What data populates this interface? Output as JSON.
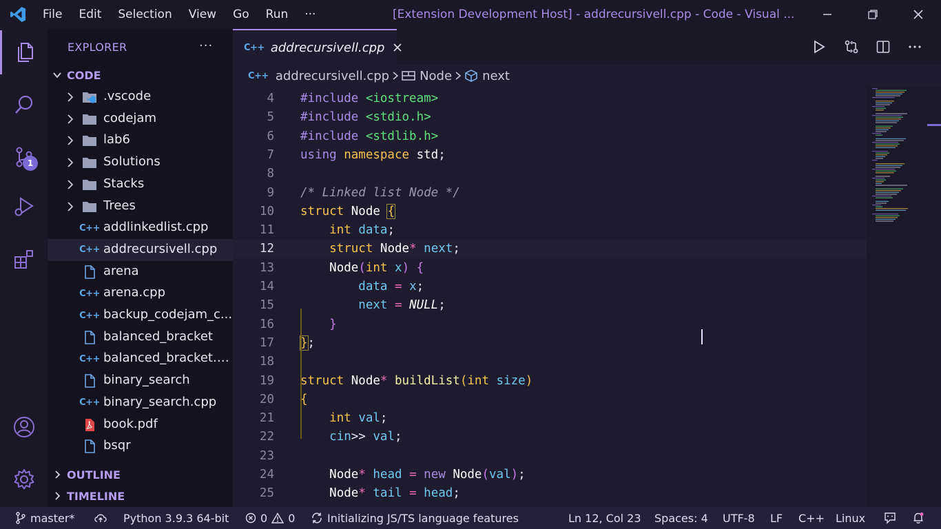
{
  "titlebar": {
    "menus": [
      "File",
      "Edit",
      "Selection",
      "View",
      "Go",
      "Run",
      "···"
    ],
    "title": "[Extension Development Host] - addrecursivell.cpp - Code - Visual ...",
    "accent": "#a98be8"
  },
  "activity": {
    "scm_badge": "1"
  },
  "sidebar": {
    "header": "EXPLORER",
    "more": "···",
    "folder": "CODE",
    "items": [
      {
        "label": ".vscode",
        "icon": "vscode-folder-icon"
      },
      {
        "label": "codejam",
        "icon": "folder-icon"
      },
      {
        "label": "lab6",
        "icon": "folder-icon"
      },
      {
        "label": "Solutions",
        "icon": "folder-icon"
      },
      {
        "label": "Stacks",
        "icon": "folder-icon"
      },
      {
        "label": "Trees",
        "icon": "folder-icon"
      },
      {
        "label": "addlinkedlist.cpp",
        "icon": "cpp-icon"
      },
      {
        "label": "addrecursivell.cpp",
        "icon": "cpp-icon"
      },
      {
        "label": "arena",
        "icon": "file-icon"
      },
      {
        "label": "arena.cpp",
        "icon": "cpp-icon"
      },
      {
        "label": "backup_codejam_c...",
        "icon": "cpp-icon"
      },
      {
        "label": "balanced_bracket",
        "icon": "file-icon"
      },
      {
        "label": "balanced_bracket.c...",
        "icon": "cpp-icon"
      },
      {
        "label": "binary_search",
        "icon": "file-icon"
      },
      {
        "label": "binary_search.cpp",
        "icon": "cpp-icon"
      },
      {
        "label": "book.pdf",
        "icon": "pdf-icon"
      },
      {
        "label": "bsqr",
        "icon": "file-icon"
      }
    ],
    "outline": "OUTLINE",
    "timeline": "TIMELINE"
  },
  "editor": {
    "tab_label": "addrecursivell.cpp",
    "cpp_glyph": "C++",
    "breadcrumb": {
      "file": "addrecursivell.cpp",
      "symbol1": "Node",
      "symbol2": "next"
    },
    "current_line": "12",
    "lines": [
      {
        "n": "4",
        "code": [
          [
            "pp",
            "#include "
          ],
          [
            "inc",
            "<iostream>"
          ]
        ]
      },
      {
        "n": "5",
        "code": [
          [
            "pp",
            "#include "
          ],
          [
            "inc",
            "<stdio.h>"
          ]
        ]
      },
      {
        "n": "6",
        "code": [
          [
            "pp",
            "#include "
          ],
          [
            "inc",
            "<stdlib.h>"
          ]
        ]
      },
      {
        "n": "7",
        "code": [
          [
            "pp",
            "using "
          ],
          [
            "kw",
            "namespace "
          ],
          [
            "cls",
            "std"
          ],
          [
            "punc",
            ";"
          ]
        ]
      },
      {
        "n": "8",
        "code": []
      },
      {
        "n": "9",
        "code": [
          [
            "cmt",
            "/* Linked list Node */"
          ]
        ]
      },
      {
        "n": "10",
        "code": [
          [
            "kw",
            "struct "
          ],
          [
            "cls",
            "Node "
          ],
          [
            "brc hlbrace",
            "{"
          ]
        ]
      },
      {
        "n": "11",
        "code": [
          [
            "punc",
            "    "
          ],
          [
            "typ",
            "int "
          ],
          [
            "var",
            "data"
          ],
          [
            "punc",
            ";"
          ]
        ]
      },
      {
        "n": "12",
        "code": [
          [
            "punc",
            "    "
          ],
          [
            "kw",
            "struct "
          ],
          [
            "cls",
            "Node"
          ],
          [
            "op",
            "* "
          ],
          [
            "var",
            "next"
          ],
          [
            "punc",
            ";"
          ]
        ]
      },
      {
        "n": "13",
        "code": [
          [
            "punc",
            "    "
          ],
          [
            "cls",
            "Node"
          ],
          [
            "par",
            "("
          ],
          [
            "typ",
            "int "
          ],
          [
            "var",
            "x"
          ],
          [
            "par",
            ") "
          ],
          [
            "par",
            "{"
          ]
        ]
      },
      {
        "n": "14",
        "code": [
          [
            "punc",
            "        "
          ],
          [
            "var",
            "data "
          ],
          [
            "op",
            "= "
          ],
          [
            "var",
            "x"
          ],
          [
            "punc",
            ";"
          ]
        ]
      },
      {
        "n": "15",
        "code": [
          [
            "punc",
            "        "
          ],
          [
            "var",
            "next "
          ],
          [
            "op",
            "= "
          ],
          [
            "nul",
            "NULL"
          ],
          [
            "punc",
            ";"
          ]
        ]
      },
      {
        "n": "16",
        "code": [
          [
            "punc",
            "    "
          ],
          [
            "par",
            "}"
          ]
        ]
      },
      {
        "n": "17",
        "code": [
          [
            "brc hlbrace",
            "}"
          ],
          [
            "punc",
            ";"
          ]
        ]
      },
      {
        "n": "18",
        "code": []
      },
      {
        "n": "19",
        "code": [
          [
            "kw",
            "struct "
          ],
          [
            "cls",
            "Node"
          ],
          [
            "op",
            "* "
          ],
          [
            "fn",
            "buildList"
          ],
          [
            "brc",
            "("
          ],
          [
            "typ",
            "int "
          ],
          [
            "var",
            "size"
          ],
          [
            "brc",
            ")"
          ]
        ]
      },
      {
        "n": "20",
        "code": [
          [
            "brc",
            "{"
          ]
        ]
      },
      {
        "n": "21",
        "code": [
          [
            "punc",
            "    "
          ],
          [
            "typ",
            "int "
          ],
          [
            "var",
            "val"
          ],
          [
            "punc",
            ";"
          ]
        ]
      },
      {
        "n": "22",
        "code": [
          [
            "punc",
            "    "
          ],
          [
            "var",
            "cin"
          ],
          [
            "punc",
            ">> "
          ],
          [
            "var",
            "val"
          ],
          [
            "punc",
            ";"
          ]
        ]
      },
      {
        "n": "23",
        "code": []
      },
      {
        "n": "24",
        "code": [
          [
            "punc",
            "    "
          ],
          [
            "cls",
            "Node"
          ],
          [
            "op",
            "* "
          ],
          [
            "var",
            "head "
          ],
          [
            "op",
            "= "
          ],
          [
            "pp",
            "new "
          ],
          [
            "cls",
            "Node"
          ],
          [
            "par",
            "("
          ],
          [
            "var",
            "val"
          ],
          [
            "par",
            ")"
          ],
          [
            "punc",
            ";"
          ]
        ]
      },
      {
        "n": "25",
        "code": [
          [
            "punc",
            "    "
          ],
          [
            "cls",
            "Node"
          ],
          [
            "op",
            "* "
          ],
          [
            "var",
            "tail "
          ],
          [
            "op",
            "= "
          ],
          [
            "var",
            "head"
          ],
          [
            "punc",
            ";"
          ]
        ]
      }
    ]
  },
  "status": {
    "branch": "master*",
    "python": "Python 3.9.3 64-bit",
    "errors": "0",
    "warnings": "0",
    "progress": "Initializing JS/TS language features",
    "position": "Ln 12, Col 23",
    "spaces": "Spaces: 4",
    "encoding": "UTF-8",
    "eol": "LF",
    "language": "C++",
    "os": "Linux"
  }
}
